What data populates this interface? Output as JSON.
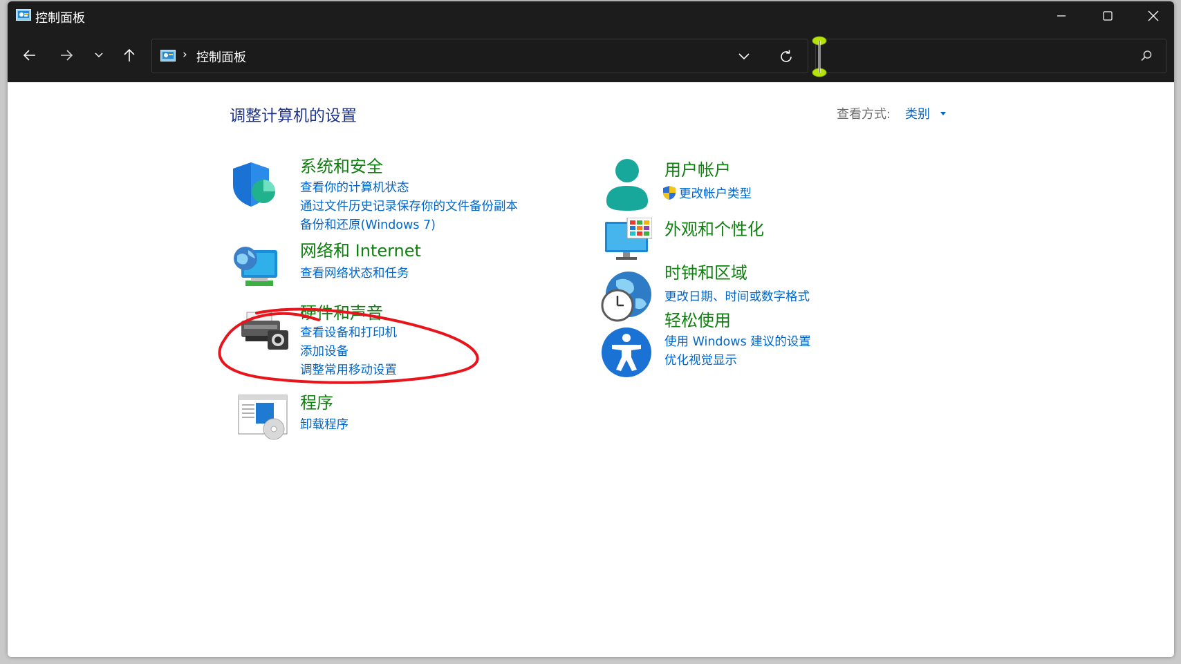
{
  "window": {
    "title": "控制面板"
  },
  "address": {
    "crumb": "控制面板",
    "separator": "›"
  },
  "search": {
    "placeholder": ""
  },
  "header": {
    "title": "调整计算机的设置",
    "view_label": "查看方式:",
    "view_value": "类别"
  },
  "categories": {
    "system": {
      "title": "系统和安全",
      "links": [
        "查看你的计算机状态",
        "通过文件历史记录保存你的文件备份副本",
        "备份和还原(Windows 7)"
      ]
    },
    "network": {
      "title": "网络和 Internet",
      "links": [
        "查看网络状态和任务"
      ]
    },
    "hardware": {
      "title": "硬件和声音",
      "links": [
        "查看设备和打印机",
        "添加设备",
        "调整常用移动设置"
      ]
    },
    "programs": {
      "title": "程序",
      "links": [
        "卸载程序"
      ]
    },
    "users": {
      "title": "用户帐户",
      "links": [
        "更改帐户类型"
      ]
    },
    "appearance": {
      "title": "外观和个性化",
      "links": []
    },
    "clock": {
      "title": "时钟和区域",
      "links": [
        "更改日期、时间或数字格式"
      ]
    },
    "ease": {
      "title": "轻松使用",
      "links": [
        "使用 Windows 建议的设置",
        "优化视觉显示"
      ]
    }
  },
  "colors": {
    "title_bar": "#1c1c1c",
    "category_title": "#0f7f0f",
    "link": "#0066cc",
    "page_title": "#1e3287",
    "annotation": "#e8141b"
  }
}
